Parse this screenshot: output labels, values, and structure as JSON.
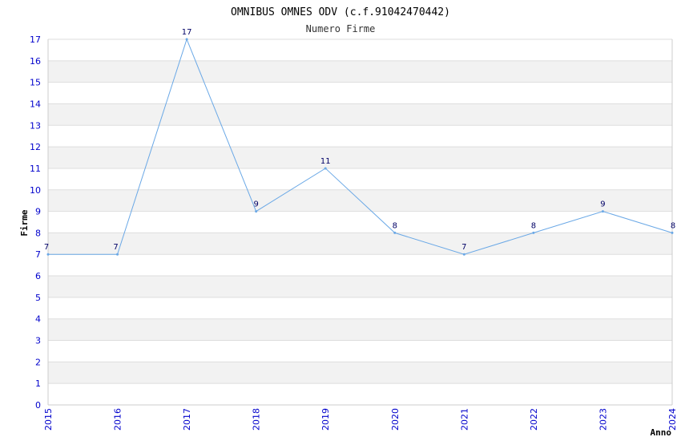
{
  "chart_data": {
    "type": "line",
    "title": "OMNIBUS OMNES ODV (c.f.91042470442)",
    "subtitle": "Numero Firme",
    "xlabel": "Anno",
    "ylabel": "Firme",
    "x": [
      "2015",
      "2016",
      "2017",
      "2018",
      "2019",
      "2020",
      "2021",
      "2022",
      "2023",
      "2024"
    ],
    "series": [
      {
        "values": [
          7,
          7,
          17,
          9,
          11,
          8,
          7,
          8,
          9,
          8
        ]
      }
    ],
    "ylim": [
      0,
      17
    ],
    "yticks": [
      0,
      1,
      2,
      3,
      4,
      5,
      6,
      7,
      8,
      9,
      10,
      11,
      12,
      13,
      14,
      15,
      16,
      17
    ],
    "grid": "horizontal bands",
    "colors": {
      "line": "#6aa8e6",
      "tick_labels": "#0000cc",
      "data_labels": "#000066",
      "band": "#f2f2f2",
      "grid": "#dddddd",
      "axis": "#cccccc"
    }
  }
}
